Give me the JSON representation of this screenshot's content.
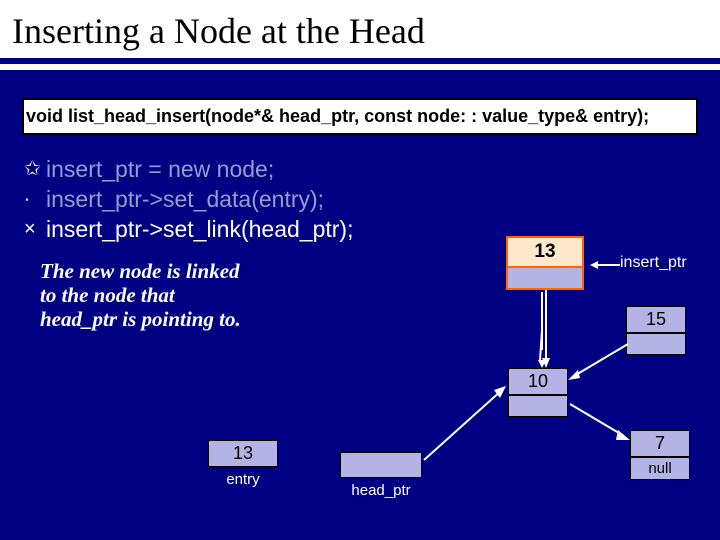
{
  "title": "Inserting a Node at the Head",
  "signature": "void list_head_insert(node*& head_ptr, const node: : value_type& entry);",
  "bullets": [
    {
      "icon": "✩",
      "text": "insert_ptr = new node;",
      "dim": true
    },
    {
      "icon": "∙",
      "text": "insert_ptr->set_data(entry);",
      "dim": true
    },
    {
      "icon": "×",
      "text": "insert_ptr->set_link(head_ptr);",
      "dim": false
    }
  ],
  "caption_line1": "The new node is linked",
  "caption_line2": "to the node that",
  "caption_line3": "head_ptr is pointing to.",
  "entry": {
    "value": "13",
    "label": "entry"
  },
  "head_ptr_label": "head_ptr",
  "insert_ptr_label": "insert_ptr",
  "nodes": {
    "insert": {
      "data": "13"
    },
    "n1": {
      "data": "15",
      "next": ""
    },
    "n2": {
      "data": "10",
      "next": ""
    },
    "n3": {
      "data": "7",
      "next": "null"
    }
  }
}
